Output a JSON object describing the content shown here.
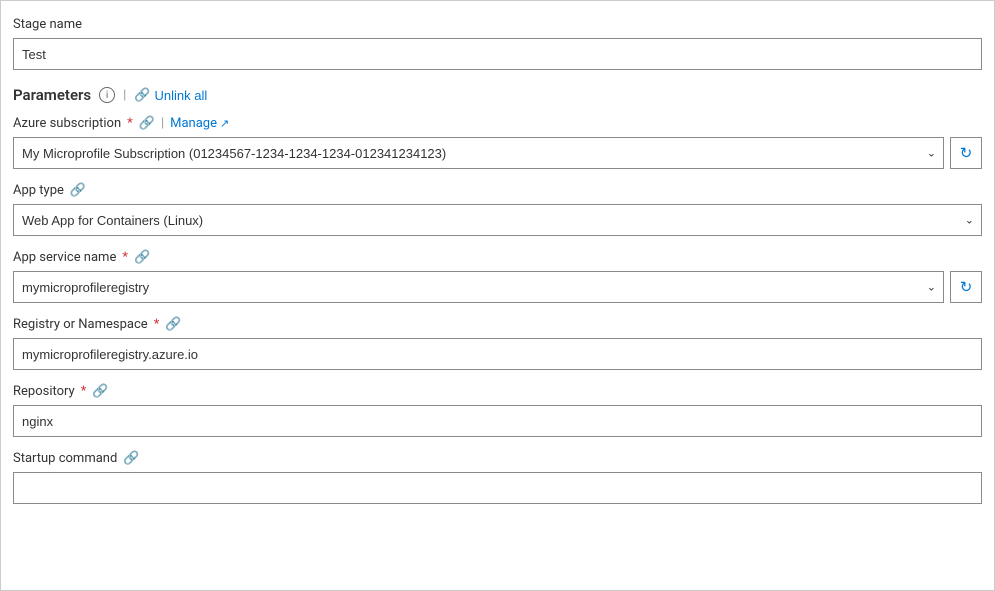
{
  "stage": {
    "label": "Stage name",
    "value": "Test"
  },
  "parameters": {
    "title": "Parameters",
    "info_icon": "ℹ",
    "unlink_all_label": "Unlink all"
  },
  "azure_subscription": {
    "label": "Azure subscription",
    "required": true,
    "manage_label": "Manage",
    "value": "My Microprofile Subscription (01234567-1234-1234-1234-012341234123)"
  },
  "app_type": {
    "label": "App type",
    "value": "Web App for Containers (Linux)"
  },
  "app_service_name": {
    "label": "App service name",
    "required": true,
    "value": "mymicroprofileregistry"
  },
  "registry_namespace": {
    "label": "Registry or Namespace",
    "required": true,
    "value": "mymicroprofileregistry.azure.io"
  },
  "repository": {
    "label": "Repository",
    "required": true,
    "value": "nginx"
  },
  "startup_command": {
    "label": "Startup command",
    "value": ""
  },
  "icons": {
    "chain": "🔗",
    "refresh": "↻",
    "chevron_down": "⌄",
    "external": "↗",
    "info": "i"
  }
}
